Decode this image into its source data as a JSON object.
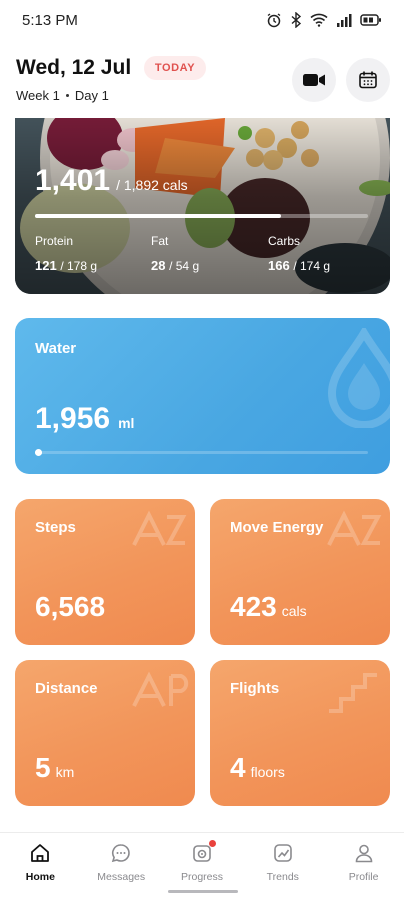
{
  "status_bar": {
    "time": "5:13 PM"
  },
  "header": {
    "date": "Wed, 12 Jul",
    "badge": "TODAY",
    "week": "Week 1",
    "day": "Day 1"
  },
  "nutrition": {
    "calories_consumed": "1,401",
    "calories_target": "/ 1,892 cals",
    "calories_progress": 0.74,
    "macros": [
      {
        "label": "Protein",
        "value": "121",
        "total": "/ 178 g"
      },
      {
        "label": "Fat",
        "value": "28",
        "total": "/ 54 g"
      },
      {
        "label": "Carbs",
        "value": "166",
        "total": "/ 174 g"
      }
    ]
  },
  "water": {
    "title": "Water",
    "value": "1,956",
    "unit": "ml",
    "progress": 0.02
  },
  "metrics": {
    "steps": {
      "title": "Steps",
      "value": "6,568",
      "unit": ""
    },
    "move_energy": {
      "title": "Move Energy",
      "value": "423",
      "unit": "cals"
    },
    "distance": {
      "title": "Distance",
      "value": "5",
      "unit": "km"
    },
    "flights": {
      "title": "Flights",
      "value": "4",
      "unit": "floors"
    }
  },
  "nav": {
    "items": [
      {
        "label": "Home",
        "icon": "home-icon",
        "active": true
      },
      {
        "label": "Messages",
        "icon": "chat-icon",
        "active": false
      },
      {
        "label": "Progress",
        "icon": "progress-icon",
        "active": false
      },
      {
        "label": "Trends",
        "icon": "trends-icon",
        "active": false
      },
      {
        "label": "Profile",
        "icon": "person-icon",
        "active": false
      }
    ]
  },
  "colors": {
    "today_badge_bg": "#fdecec",
    "today_badge_text": "#e0524f",
    "water_card": "#4aa8e3",
    "metric_card": "#f29657",
    "notification": "#e9413c"
  }
}
